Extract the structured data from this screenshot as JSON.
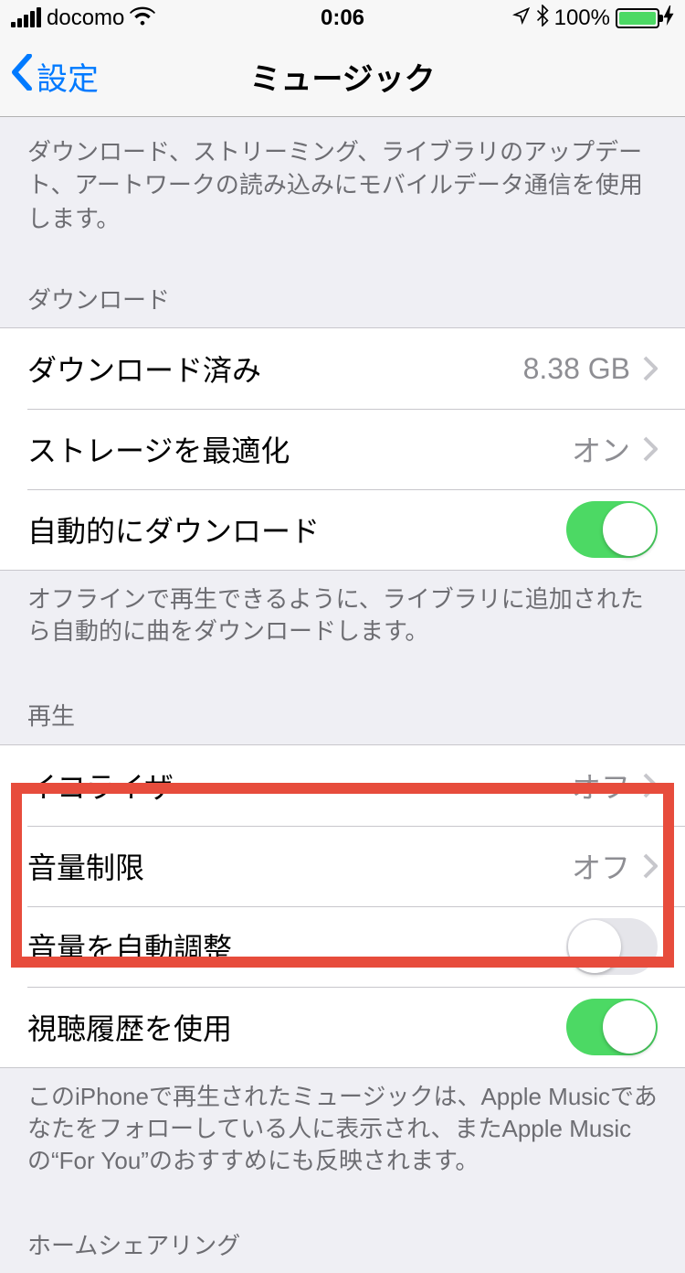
{
  "status": {
    "carrier": "docomo",
    "time": "0:06",
    "battery_pct": "100%"
  },
  "nav": {
    "back_label": "設定",
    "title": "ミュージック"
  },
  "top_description": "ダウンロード、ストリーミング、ライブラリのアップデート、アートワークの読み込みにモバイルデータ通信を使用します。",
  "download_section": {
    "header": "ダウンロード",
    "downloaded_label": "ダウンロード済み",
    "downloaded_value": "8.38 GB",
    "optimize_label": "ストレージを最適化",
    "optimize_value": "オン",
    "auto_download_label": "自動的にダウンロード",
    "footer": "オフラインで再生できるように、ライブラリに追加されたら自動的に曲をダウンロードします。"
  },
  "playback_section": {
    "header": "再生",
    "eq_label": "イコライザ",
    "eq_value": "オフ",
    "volume_limit_label": "音量制限",
    "volume_limit_value": "オフ",
    "sound_check_label": "音量を自動調整",
    "listening_history_label": "視聴履歴を使用",
    "footer": "このiPhoneで再生されたミュージックは、Apple Musicであなたをフォローしている人に表示され、またApple Musicの“For You”のおすすめにも反映されます。"
  },
  "home_sharing_section": {
    "header": "ホームシェアリング"
  }
}
